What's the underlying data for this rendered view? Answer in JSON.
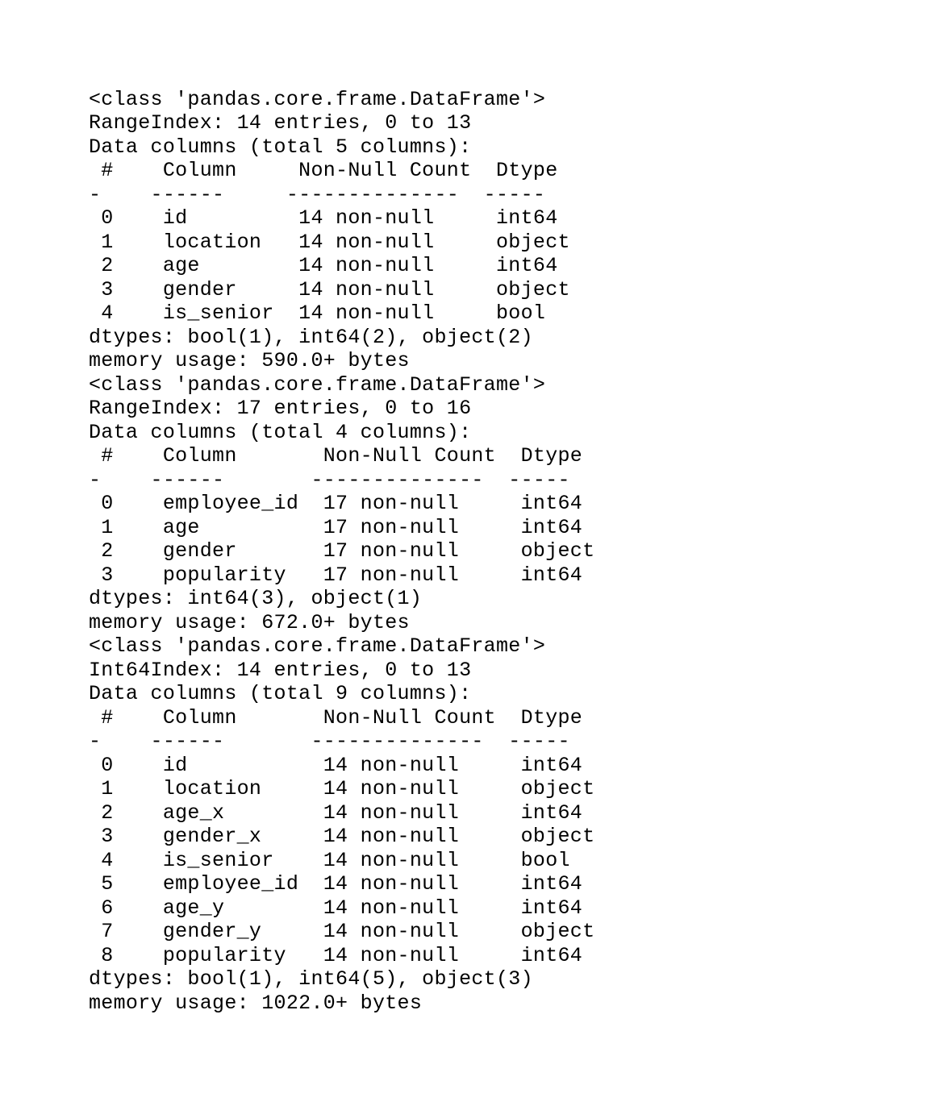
{
  "dataframes": [
    {
      "class_line": "<class 'pandas.core.frame.DataFrame'>",
      "index_line": "RangeIndex: 14 entries, 0 to 13",
      "columns_header_line": "Data columns (total 5 columns):",
      "header_widths": {
        "idx": 3,
        "col": 11,
        "nnc": 16,
        "dtype": 7
      },
      "rows": [
        {
          "idx": "0",
          "col": "id",
          "nnc": "14 non-null",
          "dtype": "int64"
        },
        {
          "idx": "1",
          "col": "location",
          "nnc": "14 non-null",
          "dtype": "object"
        },
        {
          "idx": "2",
          "col": "age",
          "nnc": "14 non-null",
          "dtype": "int64"
        },
        {
          "idx": "3",
          "col": "gender",
          "nnc": "14 non-null",
          "dtype": "object"
        },
        {
          "idx": "4",
          "col": "is_senior",
          "nnc": "14 non-null",
          "dtype": "bool"
        }
      ],
      "dtypes_line": "dtypes: bool(1), int64(2), object(2)",
      "memory_line": "memory usage: 590.0+ bytes"
    },
    {
      "class_line": "<class 'pandas.core.frame.DataFrame'>",
      "index_line": "RangeIndex: 17 entries, 0 to 16",
      "columns_header_line": "Data columns (total 4 columns):",
      "header_widths": {
        "idx": 3,
        "col": 13,
        "nnc": 16,
        "dtype": 7
      },
      "rows": [
        {
          "idx": "0",
          "col": "employee_id",
          "nnc": "17 non-null",
          "dtype": "int64"
        },
        {
          "idx": "1",
          "col": "age",
          "nnc": "17 non-null",
          "dtype": "int64"
        },
        {
          "idx": "2",
          "col": "gender",
          "nnc": "17 non-null",
          "dtype": "object"
        },
        {
          "idx": "3",
          "col": "popularity",
          "nnc": "17 non-null",
          "dtype": "int64"
        }
      ],
      "dtypes_line": "dtypes: int64(3), object(1)",
      "memory_line": "memory usage: 672.0+ bytes"
    },
    {
      "class_line": "<class 'pandas.core.frame.DataFrame'>",
      "index_line": "Int64Index: 14 entries, 0 to 13",
      "columns_header_line": "Data columns (total 9 columns):",
      "header_widths": {
        "idx": 3,
        "col": 13,
        "nnc": 16,
        "dtype": 7
      },
      "rows": [
        {
          "idx": "0",
          "col": "id",
          "nnc": "14 non-null",
          "dtype": "int64"
        },
        {
          "idx": "1",
          "col": "location",
          "nnc": "14 non-null",
          "dtype": "object"
        },
        {
          "idx": "2",
          "col": "age_x",
          "nnc": "14 non-null",
          "dtype": "int64"
        },
        {
          "idx": "3",
          "col": "gender_x",
          "nnc": "14 non-null",
          "dtype": "object"
        },
        {
          "idx": "4",
          "col": "is_senior",
          "nnc": "14 non-null",
          "dtype": "bool"
        },
        {
          "idx": "5",
          "col": "employee_id",
          "nnc": "14 non-null",
          "dtype": "int64"
        },
        {
          "idx": "6",
          "col": "age_y",
          "nnc": "14 non-null",
          "dtype": "int64"
        },
        {
          "idx": "7",
          "col": "gender_y",
          "nnc": "14 non-null",
          "dtype": "object"
        },
        {
          "idx": "8",
          "col": "popularity",
          "nnc": "14 non-null",
          "dtype": "int64"
        }
      ],
      "dtypes_line": "dtypes: bool(1), int64(5), object(3)",
      "memory_line": "memory usage: 1022.0+ bytes"
    }
  ],
  "column_header_labels": {
    "idx": "#",
    "col": "Column",
    "nnc": "Non-Null Count",
    "dtype": "Dtype"
  }
}
